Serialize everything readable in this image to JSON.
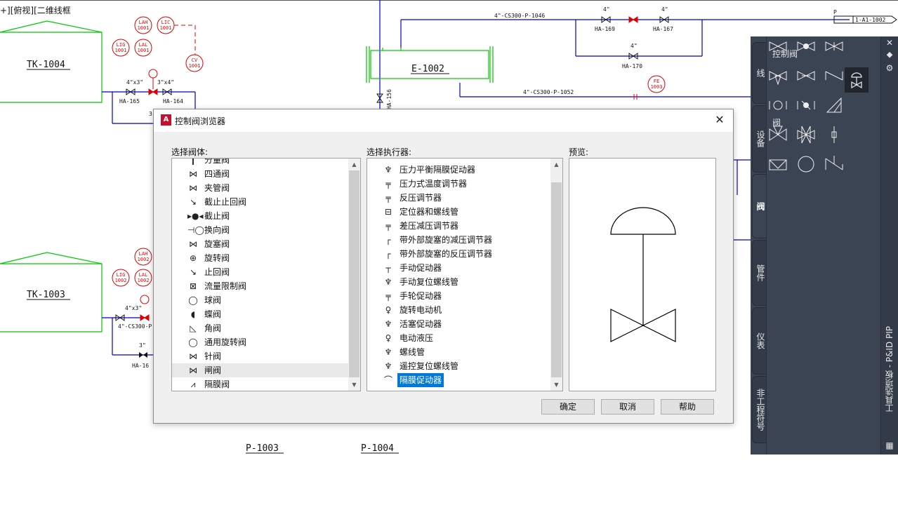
{
  "viewport_label": "+][俯视][二维线框",
  "drawing": {
    "tanks": [
      "TK-1004",
      "TK-1003"
    ],
    "pumps": [
      "P-1003",
      "P-1004"
    ],
    "exchanger": "E-1002",
    "valve_tags": [
      "HA-165",
      "HA-164",
      "HA-169",
      "HA-167",
      "HA-170",
      "HA-156",
      "HA-16"
    ],
    "instrument_tags": [
      "LAH 1001",
      "LIC 1001",
      "LIG 1001",
      "LAL 1001",
      "LAH 1002",
      "LIG 1002",
      "LAL 1002",
      "CV 1001",
      "FE 1003"
    ],
    "line_labels": [
      "4\"-CS300-P-1046",
      "4\"-CS300-P-1052",
      "4\"-CS300-P",
      "1-A1-1002"
    ],
    "sizes": [
      "4\"",
      "4\"x3\"",
      "3\"x4\"",
      "4\"x3\"",
      "3\"",
      "3\""
    ]
  },
  "dialog": {
    "title": "控制阀浏览器",
    "close_glyph": "✕",
    "body_label": "选择阀体:",
    "actuator_label": "选择执行器:",
    "preview_label": "预览:",
    "bodies": [
      {
        "glyph": "┃",
        "label": "分量阀"
      },
      {
        "glyph": "⋈",
        "label": "四通阀"
      },
      {
        "glyph": "⋈",
        "label": "夹管阀"
      },
      {
        "glyph": "↘",
        "label": "截止止回阀"
      },
      {
        "glyph": "▸●◂",
        "label": "截止阀"
      },
      {
        "glyph": "⊣◯",
        "label": "换向阀"
      },
      {
        "glyph": "⋈",
        "label": "旋塞阀"
      },
      {
        "glyph": "⊕",
        "label": "旋转阀"
      },
      {
        "glyph": "↘",
        "label": "止回阀"
      },
      {
        "glyph": "⊠",
        "label": "流量限制阀"
      },
      {
        "glyph": "◯",
        "label": "球阀"
      },
      {
        "glyph": "◖",
        "label": "蝶阀"
      },
      {
        "glyph": "◺",
        "label": "角阀"
      },
      {
        "glyph": "◯",
        "label": "通用旋转阀"
      },
      {
        "glyph": "⋈",
        "label": "针阀"
      },
      {
        "glyph": "⋈",
        "label": "闸阀"
      },
      {
        "glyph": "⩘",
        "label": "隔膜阀"
      }
    ],
    "actuators": [
      {
        "glyph": "♆",
        "label": "压力平衡隔膜促动器"
      },
      {
        "glyph": "╤",
        "label": "压力式温度调节器"
      },
      {
        "glyph": "╤",
        "label": "反压调节器"
      },
      {
        "glyph": "⊟",
        "label": "定位器和螺线管"
      },
      {
        "glyph": "╤",
        "label": "差压减压调节器"
      },
      {
        "glyph": "┌",
        "label": "带外部旋塞的减压调节器"
      },
      {
        "glyph": "┌",
        "label": "带外部旋塞的反压调节器"
      },
      {
        "glyph": "┬",
        "label": "手动促动器"
      },
      {
        "glyph": "♆",
        "label": "手动复位螺线管"
      },
      {
        "glyph": "╤",
        "label": "手轮促动器"
      },
      {
        "glyph": "♀",
        "label": "旋转电动机"
      },
      {
        "glyph": "♆",
        "label": "活塞促动器"
      },
      {
        "glyph": "♀",
        "label": "电动液压"
      },
      {
        "glyph": "♆",
        "label": "螺线管"
      },
      {
        "glyph": "♆",
        "label": "遥控复位螺线管"
      },
      {
        "glyph": "⌒",
        "label": "隔膜促动器"
      }
    ],
    "selected_actuator": "隔膜促动器",
    "highlighted_body": "闸阀",
    "buttons": {
      "ok": "确定",
      "cancel": "取消",
      "help": "帮助"
    }
  },
  "palette": {
    "title": "工具选项板 - P&ID PIP",
    "tabs": [
      "线",
      "设备",
      "阀",
      "管件",
      "仪表",
      "非工程符号"
    ],
    "active_tab": "阀",
    "section_control_valve": "控制阀",
    "section_valve": "阀",
    "icons": [
      "gate-valve",
      "globe-valve",
      "gate-valve-alt",
      "three-way-valve",
      "plug-valve",
      "check-valve",
      "ball-valve",
      "butterfly-valve",
      "angle-valve",
      "four-way-valve",
      "four-way-valve-alt",
      "needle-valve",
      "diaphragm-valve",
      "rotary-valve",
      "check-valve-alt"
    ],
    "strip_close": "✕",
    "strip_pin": "⯁",
    "strip_settings": "⚙"
  },
  "colors": {
    "pipe_blue": "#0000c8",
    "equip_green": "#00c800",
    "instr_red": "#e00000",
    "select": "#0078d7",
    "palette_bg": "#3b4453"
  }
}
